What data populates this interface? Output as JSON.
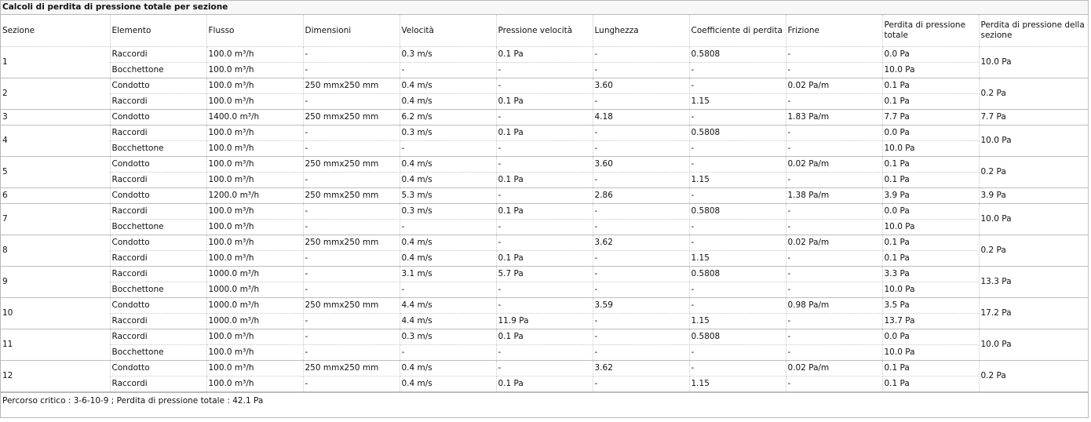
{
  "title": "Calcoli di perdita di pressione totale per sezione",
  "headers": [
    "Sezione",
    "Elemento",
    "Flusso",
    "Dimensioni",
    "Velocità",
    "Pressione velocità",
    "Lunghezza",
    "Coefficiente di perdita",
    "Frizione",
    "Perdita di pressione totale",
    "Perdita di pressione della sezione"
  ],
  "sections": [
    {
      "id": "1",
      "total": "10.0 Pa",
      "rows": [
        [
          "Raccordi",
          "100.0 m³/h",
          "-",
          "0.3 m/s",
          "0.1 Pa",
          "-",
          "0.5808",
          "-",
          "0.0 Pa"
        ],
        [
          "Bocchettone",
          "100.0 m³/h",
          "-",
          "-",
          "-",
          "-",
          "-",
          "-",
          "10.0 Pa"
        ]
      ]
    },
    {
      "id": "2",
      "total": "0.2 Pa",
      "rows": [
        [
          "Condotto",
          "100.0 m³/h",
          "250 mmx250 mm",
          "0.4 m/s",
          "-",
          "3.60",
          "-",
          "0.02 Pa/m",
          "0.1 Pa"
        ],
        [
          "Raccordi",
          "100.0 m³/h",
          "-",
          "0.4 m/s",
          "0.1 Pa",
          "-",
          "1.15",
          "-",
          "0.1 Pa"
        ]
      ]
    },
    {
      "id": "3",
      "total": "7.7 Pa",
      "rows": [
        [
          "Condotto",
          "1400.0 m³/h",
          "250 mmx250 mm",
          "6.2 m/s",
          "-",
          "4.18",
          "-",
          "1.83 Pa/m",
          "7.7 Pa"
        ]
      ]
    },
    {
      "id": "4",
      "total": "10.0 Pa",
      "rows": [
        [
          "Raccordi",
          "100.0 m³/h",
          "-",
          "0.3 m/s",
          "0.1 Pa",
          "-",
          "0.5808",
          "-",
          "0.0 Pa"
        ],
        [
          "Bocchettone",
          "100.0 m³/h",
          "-",
          "-",
          "-",
          "-",
          "-",
          "-",
          "10.0 Pa"
        ]
      ]
    },
    {
      "id": "5",
      "total": "0.2 Pa",
      "rows": [
        [
          "Condotto",
          "100.0 m³/h",
          "250 mmx250 mm",
          "0.4 m/s",
          "-",
          "3.60",
          "-",
          "0.02 Pa/m",
          "0.1 Pa"
        ],
        [
          "Raccordi",
          "100.0 m³/h",
          "-",
          "0.4 m/s",
          "0.1 Pa",
          "-",
          "1.15",
          "-",
          "0.1 Pa"
        ]
      ]
    },
    {
      "id": "6",
      "total": "3.9 Pa",
      "rows": [
        [
          "Condotto",
          "1200.0 m³/h",
          "250 mmx250 mm",
          "5.3 m/s",
          "-",
          "2.86",
          "-",
          "1.38 Pa/m",
          "3.9 Pa"
        ]
      ]
    },
    {
      "id": "7",
      "total": "10.0 Pa",
      "rows": [
        [
          "Raccordi",
          "100.0 m³/h",
          "-",
          "0.3 m/s",
          "0.1 Pa",
          "-",
          "0.5808",
          "-",
          "0.0 Pa"
        ],
        [
          "Bocchettone",
          "100.0 m³/h",
          "-",
          "-",
          "-",
          "-",
          "-",
          "-",
          "10.0 Pa"
        ]
      ]
    },
    {
      "id": "8",
      "total": "0.2 Pa",
      "rows": [
        [
          "Condotto",
          "100.0 m³/h",
          "250 mmx250 mm",
          "0.4 m/s",
          "-",
          "3.62",
          "-",
          "0.02 Pa/m",
          "0.1 Pa"
        ],
        [
          "Raccordi",
          "100.0 m³/h",
          "-",
          "0.4 m/s",
          "0.1 Pa",
          "-",
          "1.15",
          "-",
          "0.1 Pa"
        ]
      ]
    },
    {
      "id": "9",
      "total": "13.3 Pa",
      "rows": [
        [
          "Raccordi",
          "1000.0 m³/h",
          "-",
          "3.1 m/s",
          "5.7 Pa",
          "-",
          "0.5808",
          "-",
          "3.3 Pa"
        ],
        [
          "Bocchettone",
          "1000.0 m³/h",
          "-",
          "-",
          "-",
          "-",
          "-",
          "-",
          "10.0 Pa"
        ]
      ]
    },
    {
      "id": "10",
      "total": "17.2 Pa",
      "rows": [
        [
          "Condotto",
          "1000.0 m³/h",
          "250 mmx250 mm",
          "4.4 m/s",
          "-",
          "3.59",
          "-",
          "0.98 Pa/m",
          "3.5 Pa"
        ],
        [
          "Raccordi",
          "1000.0 m³/h",
          "-",
          "4.4 m/s",
          "11.9 Pa",
          "-",
          "1.15",
          "-",
          "13.7 Pa"
        ]
      ]
    },
    {
      "id": "11",
      "total": "10.0 Pa",
      "rows": [
        [
          "Raccordi",
          "100.0 m³/h",
          "-",
          "0.3 m/s",
          "0.1 Pa",
          "-",
          "0.5808",
          "-",
          "0.0 Pa"
        ],
        [
          "Bocchettone",
          "100.0 m³/h",
          "-",
          "-",
          "-",
          "-",
          "-",
          "-",
          "10.0 Pa"
        ]
      ]
    },
    {
      "id": "12",
      "total": "0.2 Pa",
      "rows": [
        [
          "Condotto",
          "100.0 m³/h",
          "250 mmx250 mm",
          "0.4 m/s",
          "-",
          "3.62",
          "-",
          "0.02 Pa/m",
          "0.1 Pa"
        ],
        [
          "Raccordi",
          "100.0 m³/h",
          "-",
          "0.4 m/s",
          "0.1 Pa",
          "-",
          "1.15",
          "-",
          "0.1 Pa"
        ]
      ]
    }
  ],
  "footer": "Percorso critico : 3-6-10-9 ; Perdita di pressione totale : 42.1 Pa"
}
